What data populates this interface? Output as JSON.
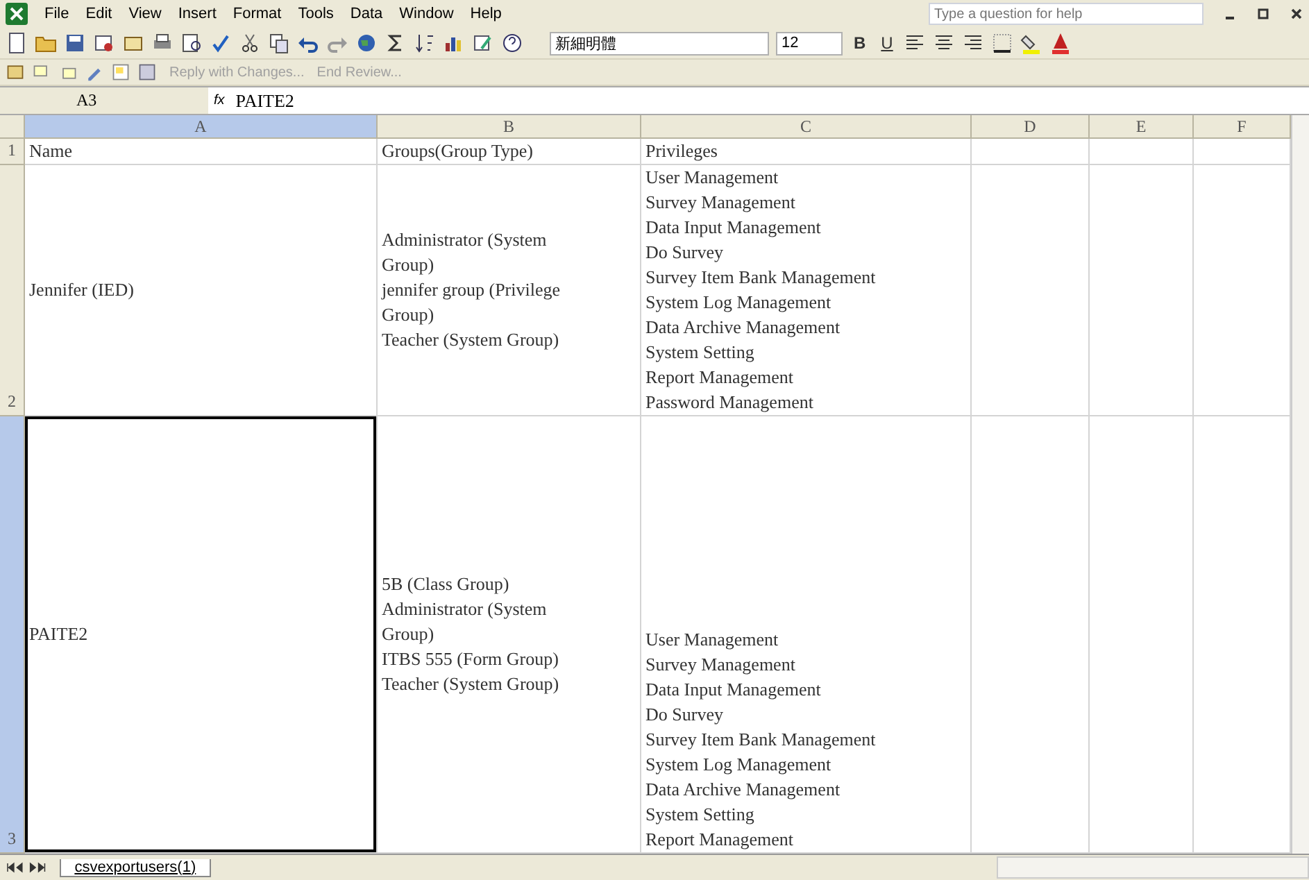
{
  "menu_bar": {
    "items": [
      "File",
      "Edit",
      "View",
      "Insert",
      "Format",
      "Tools",
      "Data",
      "Window",
      "Help"
    ],
    "help_box": {
      "placeholder": "Type a question for help"
    }
  },
  "formatting_toolbar": {
    "font_name": "新細明體",
    "font_size": "12",
    "style_buttons": [
      "B",
      "U"
    ]
  },
  "reviewing_toolbar": {
    "items": [
      "Reply with Changes...",
      "End Review..."
    ]
  },
  "formula_bar": {
    "name_box": "A3",
    "fx": "fx",
    "value": "PAITE2"
  },
  "columns": [
    {
      "label": "A",
      "selected": true
    },
    {
      "label": "B",
      "selected": false
    },
    {
      "label": "C",
      "selected": false
    },
    {
      "label": "D",
      "selected": false
    },
    {
      "label": "E",
      "selected": false
    },
    {
      "label": "F",
      "selected": false
    }
  ],
  "rows": [
    {
      "number": "1",
      "selected": false,
      "cells": [
        {
          "active": false,
          "lines": [
            "Name"
          ]
        },
        {
          "active": false,
          "lines": [
            "Groups(Group Type)"
          ]
        },
        {
          "active": false,
          "lines": [
            "Privileges"
          ]
        }
      ]
    },
    {
      "number": "2",
      "selected": false,
      "cells": [
        {
          "active": false,
          "lines": [
            "Jennifer (IED)"
          ]
        },
        {
          "active": false,
          "lines": [
            "Administrator (System",
            "Group)",
            "jennifer group (Privilege",
            "Group)",
            "Teacher (System Group)"
          ]
        },
        {
          "active": false,
          "lines": [
            "User Management",
            "Survey Management",
            "Data Input Management",
            "Do Survey",
            "Survey Item Bank Management",
            "System Log Management",
            "Data Archive Management",
            "System Setting",
            "Report Management",
            "Password Management"
          ]
        }
      ]
    },
    {
      "number": "3",
      "selected": true,
      "cells": [
        {
          "active": true,
          "lines": [
            "PAITE2"
          ]
        },
        {
          "active": false,
          "lines": [
            "5B (Class Group)",
            "Administrator (System",
            "Group)",
            "ITBS 555 (Form Group)",
            "Teacher (System Group)"
          ]
        },
        {
          "active": false,
          "lines": [
            "User Management",
            "Survey Management",
            "Data Input Management",
            "Do Survey",
            "Survey Item Bank Management",
            "System Log Management",
            "Data Archive Management",
            "System Setting",
            "Report Management"
          ]
        }
      ]
    }
  ],
  "sheet_tabs": [
    {
      "label": "csvexportusers(1)",
      "selected": true
    }
  ]
}
